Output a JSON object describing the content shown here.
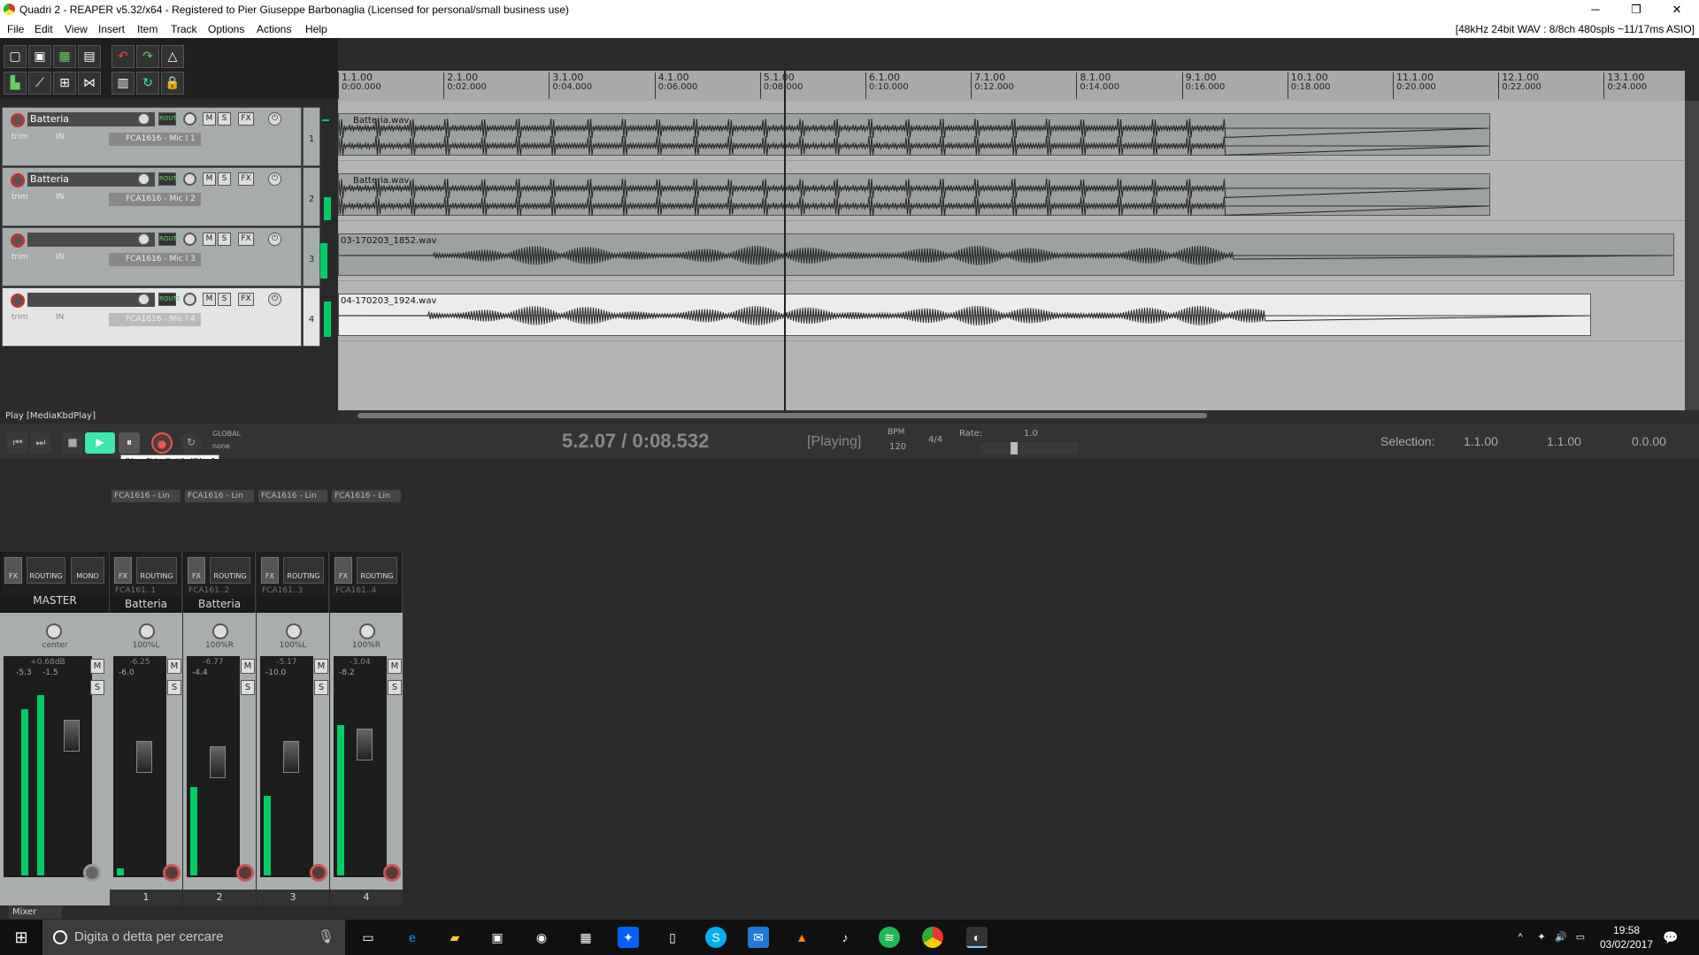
{
  "window": {
    "title": "Quadri 2 - REAPER v5.32/x64 - Registered to Pier Giuseppe Barbonaglia (Licensed for personal/small business use)",
    "minimize": "─",
    "restore": "❐",
    "close": "✕"
  },
  "menu": {
    "items": [
      "File",
      "Edit",
      "View",
      "Insert",
      "Item",
      "Track",
      "Options",
      "Actions",
      "Help"
    ],
    "audio_info": "[48kHz 24bit WAV : 8/8ch 480spls ~11/17ms ASIO]"
  },
  "ruler": {
    "marks": [
      {
        "bar": "1.1.00",
        "time": "0:00.000"
      },
      {
        "bar": "2.1.00",
        "time": "0:02.000"
      },
      {
        "bar": "3.1.00",
        "time": "0:04.000"
      },
      {
        "bar": "4.1.00",
        "time": "0:06.000"
      },
      {
        "bar": "5.1.00",
        "time": "0:08.000"
      },
      {
        "bar": "6.1.00",
        "time": "0:10.000"
      },
      {
        "bar": "7.1.00",
        "time": "0:12.000"
      },
      {
        "bar": "8.1.00",
        "time": "0:14.000"
      },
      {
        "bar": "9.1.00",
        "time": "0:16.000"
      },
      {
        "bar": "10.1.00",
        "time": "0:18.000"
      },
      {
        "bar": "11.1.00",
        "time": "0:20.000"
      },
      {
        "bar": "12.1.00",
        "time": "0:22.000"
      },
      {
        "bar": "13.1.00",
        "time": "0:24.000"
      }
    ]
  },
  "tracks": [
    {
      "num": "1",
      "name": "Batteria",
      "input": "FCA1616 - Mic I 1",
      "item": "Batteria.wav",
      "selected": false
    },
    {
      "num": "2",
      "name": "Batteria",
      "input": "FCA1616 - Mic I 2",
      "item": "Batteria.wav",
      "selected": false
    },
    {
      "num": "3",
      "name": "",
      "input": "FCA1616 - Mic I 3",
      "item": "03-170203_1852.wav",
      "selected": false
    },
    {
      "num": "4",
      "name": "",
      "input": "FCA1616 - Mic I 4",
      "item": "04-170203_1924.wav",
      "selected": true
    }
  ],
  "track_controls": {
    "mute": "M",
    "solo": "S",
    "fx": "FX",
    "route": "ROUTE",
    "trim": "trim",
    "in": "IN"
  },
  "status_text": "Play [MediaKbdPlay]",
  "transport": {
    "position": "5.2.07 / 0:08.532",
    "state": "[Playing]",
    "bpm_label": "BPM",
    "bpm": "120",
    "time_sig": "4/4",
    "rate_label": "Rate:",
    "rate": "1.0",
    "global_label": "GLOBAL",
    "global_value": "none",
    "tooltip": "Play [MediaKbdPlay]",
    "selection_label": "Selection:",
    "sel_start": "1.1.00",
    "sel_end": "1.1.00",
    "sel_len": "0.0.00"
  },
  "mixer": {
    "tab": "Mixer",
    "master": {
      "name": "MASTER",
      "pan": "center",
      "db": "+0.68dB",
      "peak_l": "-5.3",
      "peak_r": "-1.5",
      "mono": "MONO",
      "routing": "ROUTING",
      "fx": "FX"
    },
    "strips": [
      {
        "idx": "1",
        "name": "Batteria",
        "pan": "100%L",
        "db": "-6.25",
        "peak": "-6.0",
        "input": "FCA161..1",
        "fx": "FCA1616 - Lin"
      },
      {
        "idx": "2",
        "name": "Batteria",
        "pan": "100%R",
        "db": "-6.77",
        "peak": "-4.4",
        "input": "FCA161..2",
        "fx": "FCA1616 - Lin"
      },
      {
        "idx": "3",
        "name": "",
        "pan": "100%L",
        "db": "-5.17",
        "peak": "-10.0",
        "input": "FCA161..3",
        "fx": "FCA1616 - Lin"
      },
      {
        "idx": "4",
        "name": "",
        "pan": "100%R",
        "db": "-3.04",
        "peak": "-8.2",
        "input": "FCA161..4",
        "fx": "FCA1616 - Lin"
      }
    ],
    "scale": [
      "-6",
      "-12",
      "-18",
      "-24",
      "-30",
      "-36",
      "-42",
      "-48",
      "-54",
      "-60"
    ]
  },
  "taskbar": {
    "search_placeholder": "Digita o detta per cercare",
    "time": "19:58",
    "date": "03/02/2017"
  }
}
